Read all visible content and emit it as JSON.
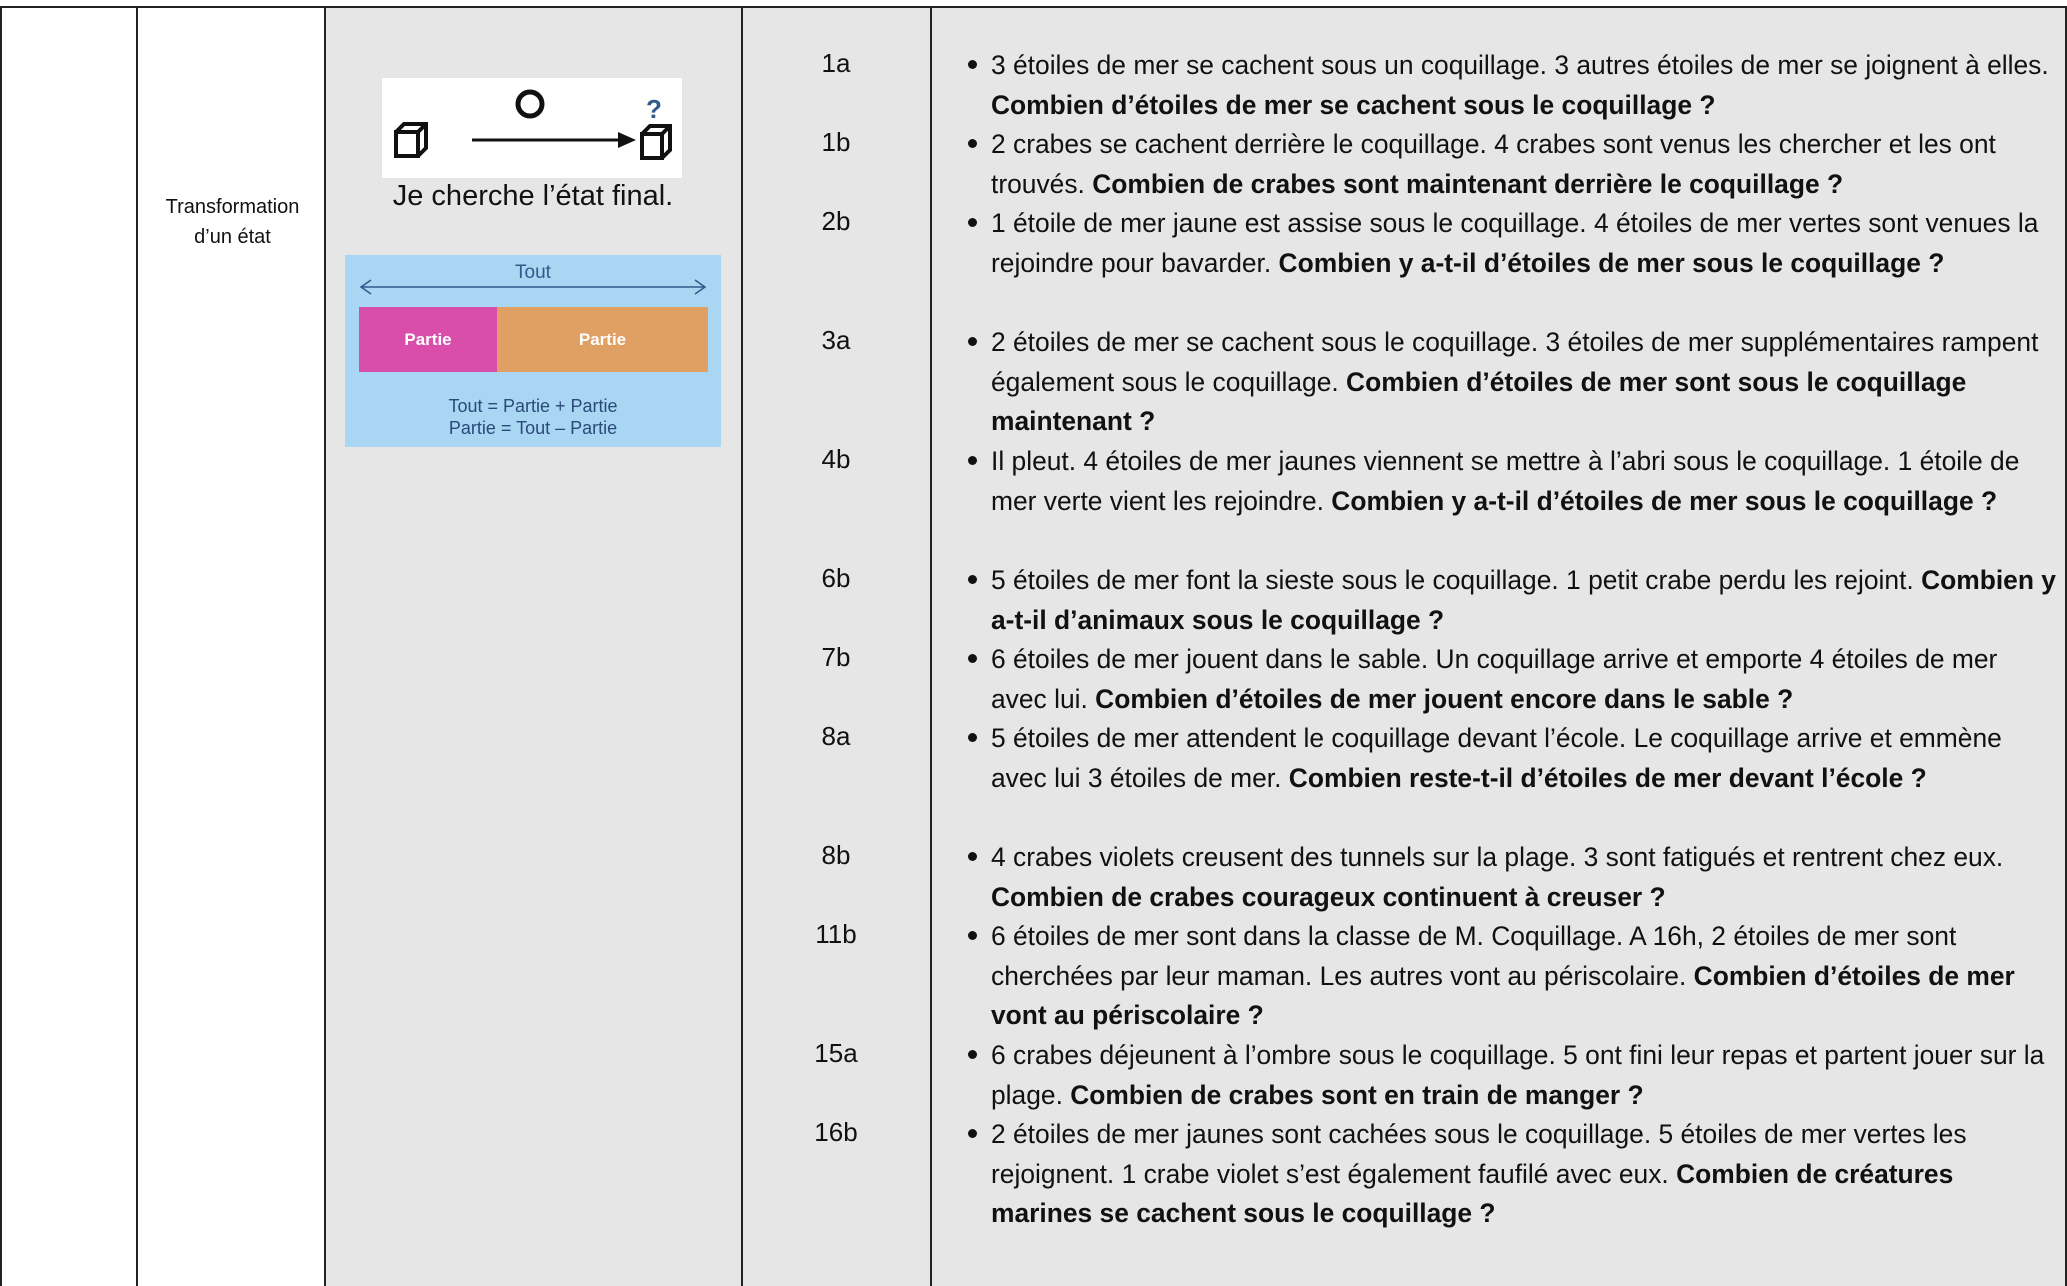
{
  "category": {
    "line1": "Transformation",
    "line2": "d’un état"
  },
  "schema": {
    "question_mark": "?",
    "caption": "Je cherche l’état final."
  },
  "model": {
    "whole_label": "Tout",
    "part_left": "Partie",
    "part_right": "Partie",
    "formula1": "Tout = Partie + Partie",
    "formula2": "Partie = Tout – Partie"
  },
  "problems": [
    {
      "id": "1a",
      "text": "3 étoiles de mer se cachent sous un coquillage. 3 autres étoiles de mer se joignent à elles. ",
      "question": "Combien d’étoiles de mer se cachent sous le coquillage ?"
    },
    {
      "id": "1b",
      "text": "2 crabes se cachent derrière le coquillage. 4 crabes sont venus les chercher et les ont trouvés. ",
      "question": "Combien de crabes sont maintenant derrière le coquillage ?"
    },
    {
      "id": "2b",
      "text": "1 étoile de mer jaune est assise sous le coquillage. 4 étoiles de mer vertes sont venues la rejoindre pour bavarder. ",
      "question": "Combien y a-t-il d’étoiles de mer sous le coquillage ?"
    },
    {
      "id": "3a",
      "text": "2 étoiles de mer se cachent sous le coquillage. 3 étoiles de mer supplémentaires rampent également sous le coquillage. ",
      "question": "Combien d’étoiles de mer sont sous le coquillage maintenant ?"
    },
    {
      "id": "4b",
      "text": "Il pleut. 4 étoiles de mer jaunes viennent se mettre à l’abri sous le coquillage. 1 étoile de mer verte vient les rejoindre. ",
      "question": "Combien y a-t-il d’étoiles de mer sous le coquillage ?"
    },
    {
      "id": "6b",
      "text": "5 étoiles de mer font la sieste sous le coquillage. 1 petit crabe perdu les rejoint. ",
      "question": "Combien y a-t-il d’animaux sous le coquillage ?"
    },
    {
      "id": "7b",
      "text": "6 étoiles de mer jouent dans le sable. Un coquillage arrive et emporte 4 étoiles de mer avec lui. ",
      "question": "Combien d’étoiles de mer jouent encore dans le sable ?"
    },
    {
      "id": "8a",
      "text": "5 étoiles de mer attendent le coquillage devant l’école. Le coquillage arrive et emmène avec lui 3 étoiles de mer. ",
      "question": "Combien reste-t-il d’étoiles de mer devant l’école ?"
    },
    {
      "id": "8b",
      "text": "4 crabes violets creusent des tunnels sur la plage. 3 sont fatigués et rentrent chez eux. ",
      "question": "Combien de crabes courageux continuent à creuser ?"
    },
    {
      "id": "11b",
      "text": "6 étoiles de mer sont dans la classe de M. Coquillage. A 16h, 2 étoiles de mer sont cherchées par leur maman. Les autres vont au périscolaire. ",
      "question": "Combien d’étoiles de mer vont au périscolaire ?"
    },
    {
      "id": "15a",
      "text": "6 crabes déjeunent à l’ombre sous le coquillage. 5 ont fini leur repas et partent jouer sur la plage. ",
      "question": "Combien de crabes sont en train de manger ?"
    },
    {
      "id": "16b",
      "text": "2 étoiles de mer jaunes sont cachées sous le coquillage. 5 étoiles de mer vertes les rejoignent. 1 crabe violet s’est également faufilé avec eux. ",
      "question": "Combien de créatures marines se cachent sous le coquillage ?"
    }
  ]
}
